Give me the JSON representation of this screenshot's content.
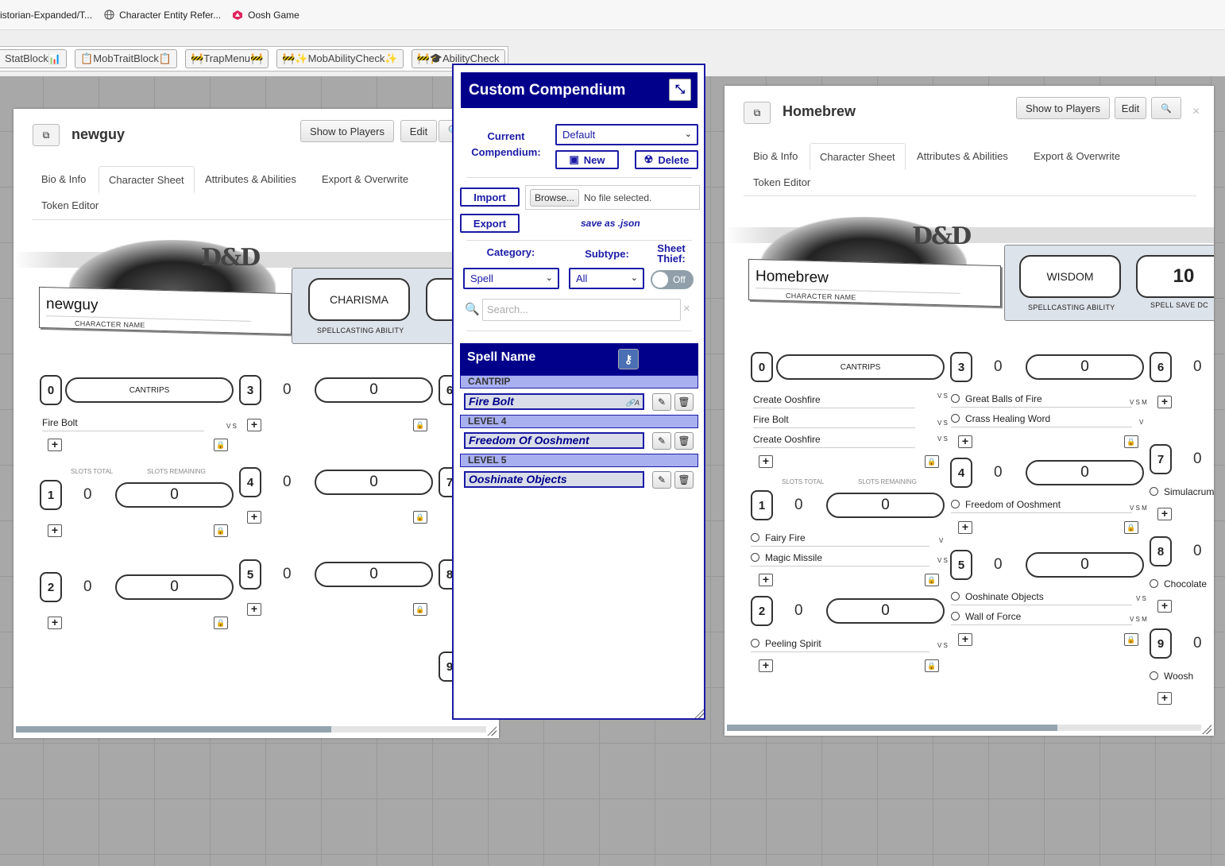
{
  "bookmarks": [
    {
      "label": "istorian-Expanded/T...",
      "icon": "page-icon"
    },
    {
      "label": "Character Entity Refer...",
      "icon": "globe-icon"
    },
    {
      "label": "Oosh Game",
      "icon": "d20-icon"
    }
  ],
  "macros": [
    {
      "label": "StatBlock📊"
    },
    {
      "label": "📋MobTraitBlock📋"
    },
    {
      "label": "🚧TrapMenu🚧"
    },
    {
      "label": "🚧✨MobAbilityCheck✨"
    },
    {
      "label": "🚧🎓AbilityCheck"
    }
  ],
  "left_sheet": {
    "title": "newguy",
    "buttons": {
      "show": "Show to Players",
      "edit": "Edit"
    },
    "tabs": [
      "Bio & Info",
      "Character Sheet",
      "Attributes & Abilities",
      "Export & Overwrite",
      "Token Editor"
    ],
    "character_name": "newguy",
    "character_name_caption": "CHARACTER NAME",
    "spellcasting_ability": "CHARISMA",
    "spellcasting_caption": "SPELLCASTING ABILITY",
    "cantrips_label": "CANTRIPS",
    "slots_total_caption": "SLOTS TOTAL",
    "slots_remaining_caption": "SLOTS REMAINING",
    "levels": [
      {
        "num": "0"
      },
      {
        "num": "1",
        "total": "0",
        "remaining": "0"
      },
      {
        "num": "2",
        "total": "0",
        "remaining": "0"
      },
      {
        "num": "3",
        "total": "0",
        "remaining": "0"
      },
      {
        "num": "4",
        "total": "0",
        "remaining": "0"
      },
      {
        "num": "5",
        "total": "0",
        "remaining": "0"
      },
      {
        "num": "6"
      },
      {
        "num": "7"
      },
      {
        "num": "8"
      },
      {
        "num": "9"
      }
    ],
    "cantrip_spells": [
      {
        "name": "Fire Bolt",
        "components": "V S"
      }
    ]
  },
  "compendium": {
    "title": "Custom Compendium",
    "current_label": "Current Compendium:",
    "current_value": "Default",
    "new_label": "New",
    "delete_label": "Delete",
    "import_label": "Import",
    "browse_label": "Browse...",
    "file_status": "No file selected.",
    "export_label": "Export",
    "save_note": "save as .json",
    "category_label": "Category:",
    "category_value": "Spell",
    "subtype_label": "Subtype:",
    "subtype_value": "All",
    "thief_label": "Sheet Thief:",
    "thief_state": "Off",
    "search_placeholder": "Search...",
    "spell_header": "Spell Name",
    "groups": [
      {
        "level": "CANTRIP",
        "spells": [
          "Fire Bolt"
        ]
      },
      {
        "level": "LEVEL 4",
        "spells": [
          "Freedom Of Ooshment"
        ]
      },
      {
        "level": "LEVEL 5",
        "spells": [
          "Ooshinate Objects"
        ]
      }
    ],
    "link_icon_text": "🔗A",
    "colors": {
      "accent": "#1a1aa6",
      "header": "#00008b",
      "level_bg": "#a9b0f0"
    }
  },
  "right_sheet": {
    "title": "Homebrew",
    "buttons": {
      "show": "Show to Players",
      "edit": "Edit"
    },
    "tabs": [
      "Bio & Info",
      "Character Sheet",
      "Attributes & Abilities",
      "Export & Overwrite",
      "Token Editor"
    ],
    "character_name": "Homebrew",
    "character_name_caption": "CHARACTER NAME",
    "spellcasting_ability": "WISDOM",
    "spellcasting_caption": "SPELLCASTING ABILITY",
    "spell_save_dc": "10",
    "spell_save_caption": "SPELL SAVE DC",
    "cantrips_label": "CANTRIPS",
    "slots_total_caption": "SLOTS TOTAL",
    "slots_remaining_caption": "SLOTS REMAINING",
    "levels": [
      {
        "num": "0"
      },
      {
        "num": "1",
        "total": "0",
        "remaining": "0"
      },
      {
        "num": "2",
        "total": "0",
        "remaining": "0"
      },
      {
        "num": "3",
        "total": "0",
        "remaining": "0"
      },
      {
        "num": "4",
        "total": "0",
        "remaining": "0"
      },
      {
        "num": "5",
        "total": "0",
        "remaining": "0"
      },
      {
        "num": "6",
        "total": "0"
      },
      {
        "num": "7",
        "total": "0"
      },
      {
        "num": "8",
        "total": "0"
      },
      {
        "num": "9",
        "total": "0"
      }
    ],
    "cantrip_spells": [
      {
        "name": "Create Ooshfire",
        "components": "V S"
      },
      {
        "name": "Fire Bolt",
        "components": "V S"
      },
      {
        "name": "Create Ooshfire",
        "components": "V S"
      }
    ],
    "level1_spells": [
      {
        "name": "Fairy Fire",
        "components": "V"
      },
      {
        "name": "Magic Missile",
        "components": "V S"
      }
    ],
    "level2_spells": [
      {
        "name": "Peeling Spirit",
        "components": "V S"
      }
    ],
    "level3_spells": [
      {
        "name": "Great Balls of Fire",
        "components": "V S M"
      },
      {
        "name": "Crass Healing Word",
        "components": "V"
      }
    ],
    "level4_spells": [
      {
        "name": "Freedom of Ooshment",
        "components": "V S M"
      }
    ],
    "level5_spells": [
      {
        "name": "Ooshinate Objects",
        "components": "V S"
      },
      {
        "name": "Wall of Force",
        "components": "V S M"
      }
    ],
    "level7_spells": [
      {
        "name": "Simulacrum"
      }
    ],
    "level8_spells": [
      {
        "name": "Chocolate"
      }
    ],
    "level9_spells": [
      {
        "name": "Woosh"
      }
    ]
  }
}
